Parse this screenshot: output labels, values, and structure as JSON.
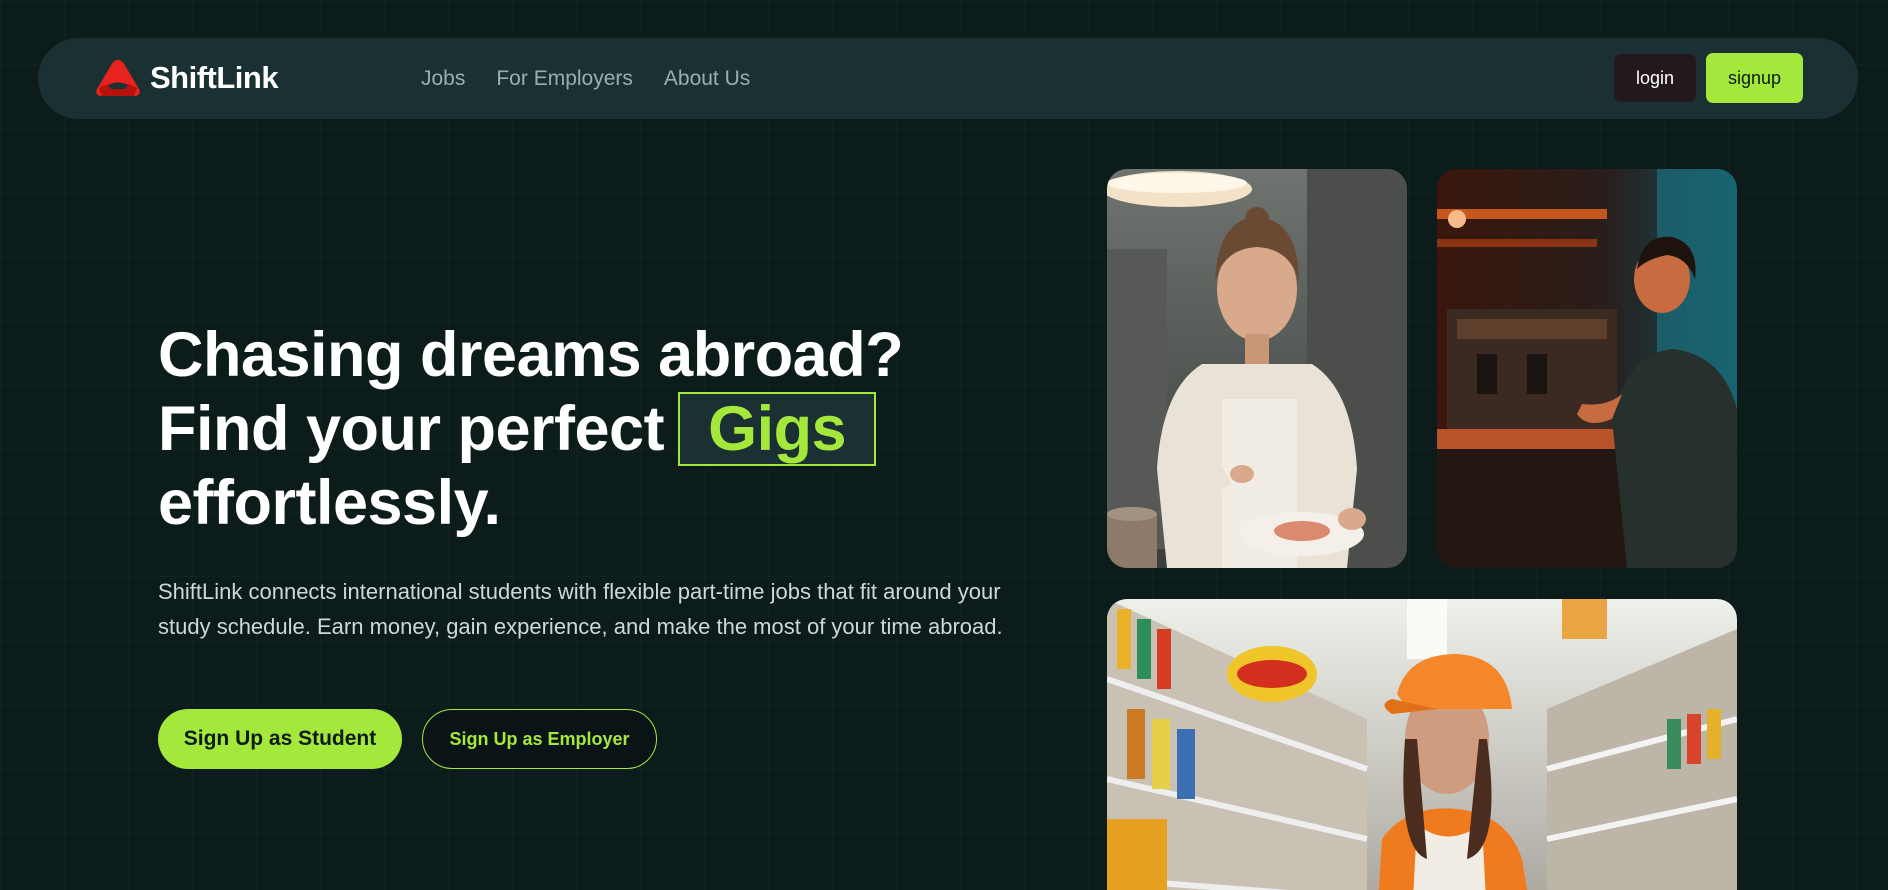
{
  "brand": {
    "name": "ShiftLink",
    "logo_icon": "triangle-logo-icon",
    "logo_color": "#e8221c"
  },
  "nav": {
    "links": [
      "Jobs",
      "For Employers",
      "About Us"
    ],
    "login_label": "login",
    "signup_label": "signup"
  },
  "hero": {
    "headline_line1": "Chasing dreams abroad?",
    "headline_line2": "Find your perfect",
    "highlight_word": "Gigs",
    "headline_line3": "effortlessly.",
    "description": "ShiftLink connects international students with flexible part-time jobs that fit around your study schedule. Earn money, gain experience, and make the most of your time abroad.",
    "student_button": "Sign Up as Student",
    "employer_button": "Sign Up as Employer"
  },
  "photos": [
    {
      "name": "chef-photo",
      "subject": "chef plating food in kitchen"
    },
    {
      "name": "barista-photo",
      "subject": "barista at espresso machine"
    },
    {
      "name": "grocery-photo",
      "subject": "worker in orange cap in supermarket aisle"
    }
  ],
  "colors": {
    "background": "#0b1c1a",
    "navbar": "#1b3033",
    "accent": "#a5e83c",
    "text": "#ffffff",
    "nav_link": "#98aeb0"
  }
}
